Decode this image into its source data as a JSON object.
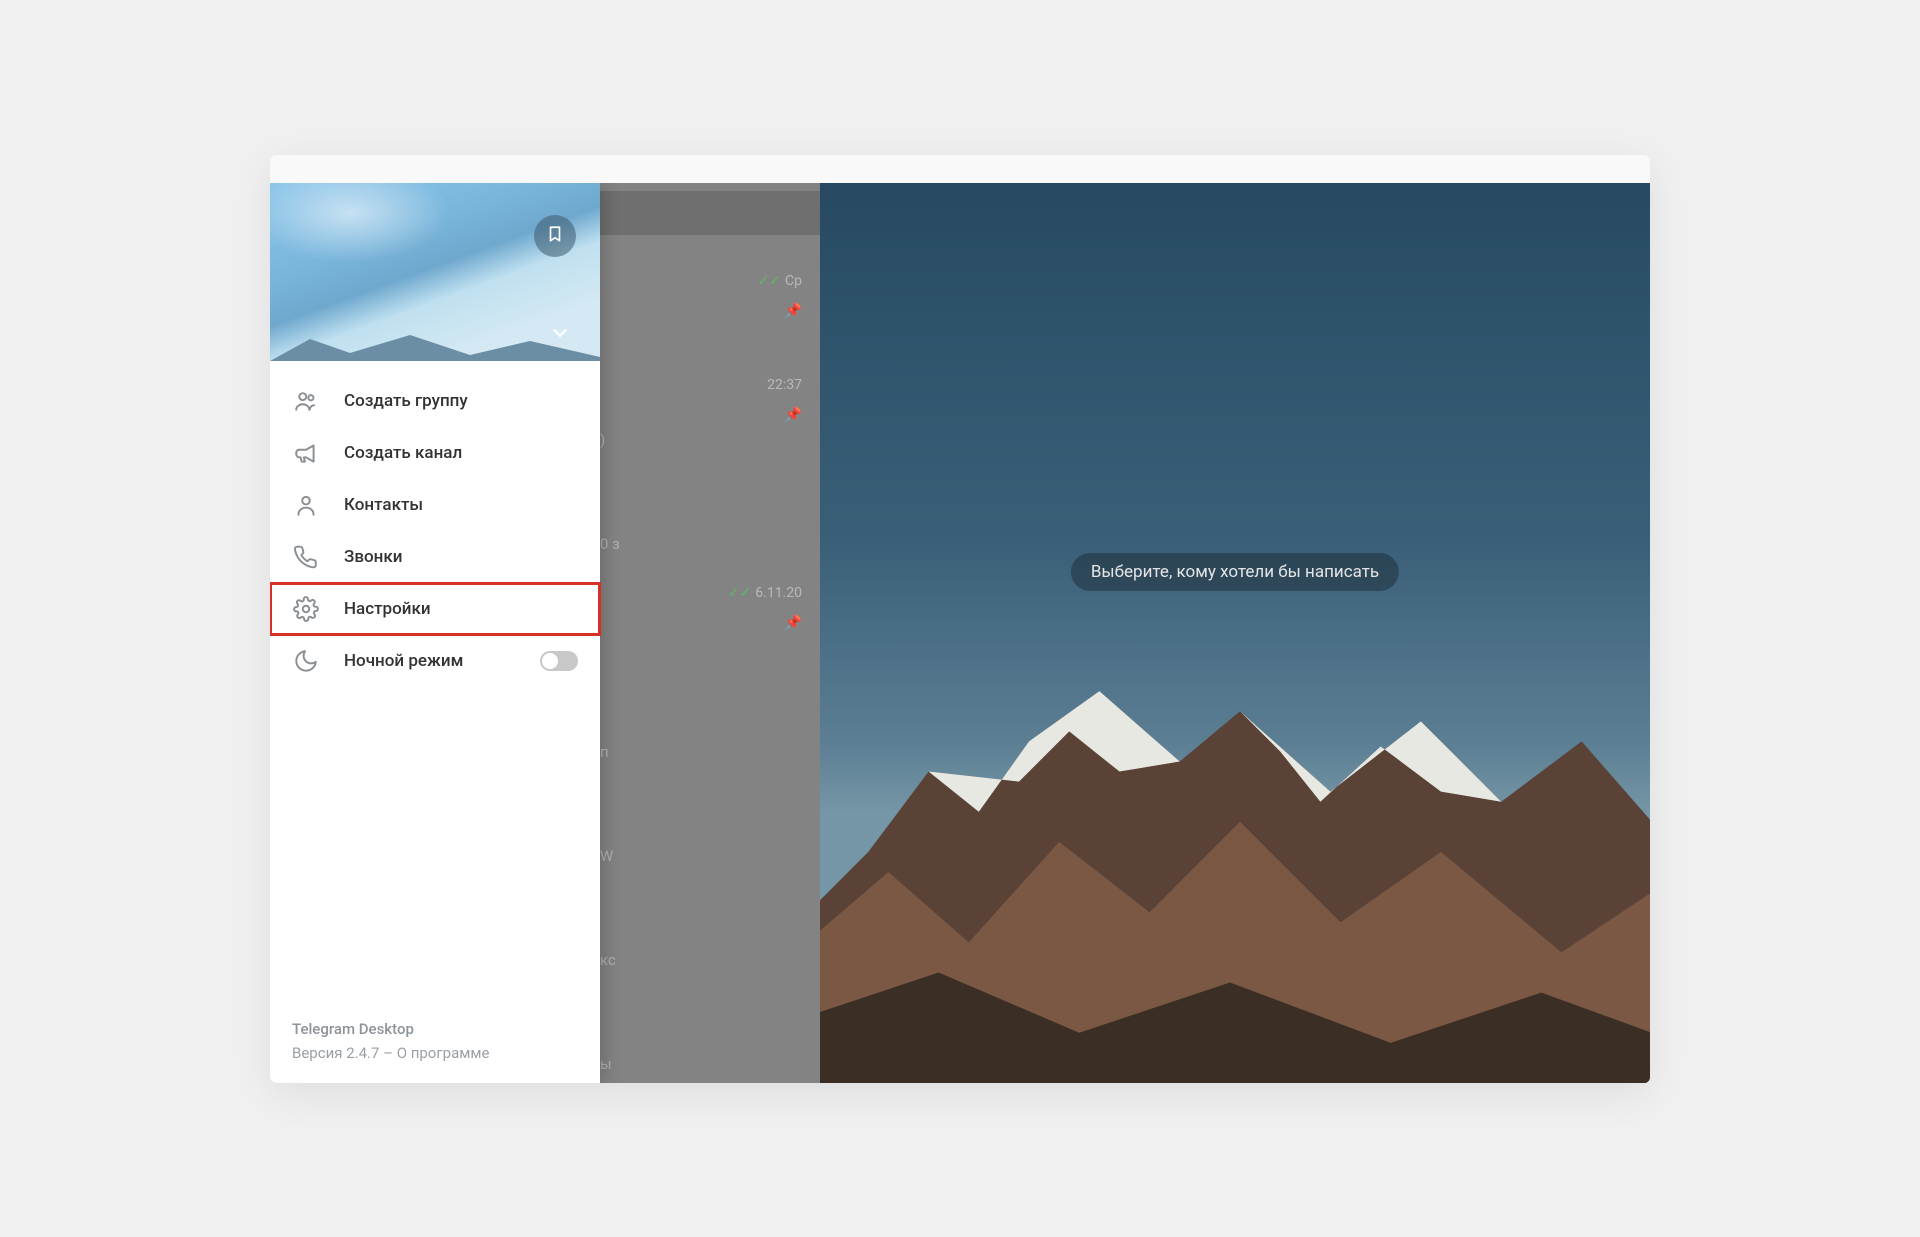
{
  "menu": {
    "new_group": "Создать группу",
    "new_channel": "Создать канал",
    "contacts": "Контакты",
    "calls": "Звонки",
    "settings": "Настройки",
    "night_mode": "Ночной режим"
  },
  "footer": {
    "app_name": "Telegram Desktop",
    "version_prefix": "Версия ",
    "version": "2.4.7",
    "separator": " – ",
    "about": "О программе"
  },
  "main": {
    "empty_hint": "Выберите, кому хотели бы написать"
  },
  "chats": [
    {
      "time": "Ср",
      "checks": true,
      "pinned": true,
      "frag": ""
    },
    {
      "time": "22:37",
      "checks": false,
      "pinned": true,
      "frag": ")"
    },
    {
      "time": "",
      "checks": false,
      "pinned": false,
      "frag": "0 з"
    },
    {
      "time": "6.11.20",
      "checks": true,
      "pinned": true,
      "frag": ""
    },
    {
      "time": "",
      "checks": false,
      "pinned": false,
      "frag": "п"
    },
    {
      "time": "",
      "checks": false,
      "pinned": false,
      "frag": "W"
    },
    {
      "time": "",
      "checks": false,
      "pinned": false,
      "frag": "кс"
    },
    {
      "time": "",
      "checks": false,
      "pinned": false,
      "frag": "ы "
    }
  ]
}
